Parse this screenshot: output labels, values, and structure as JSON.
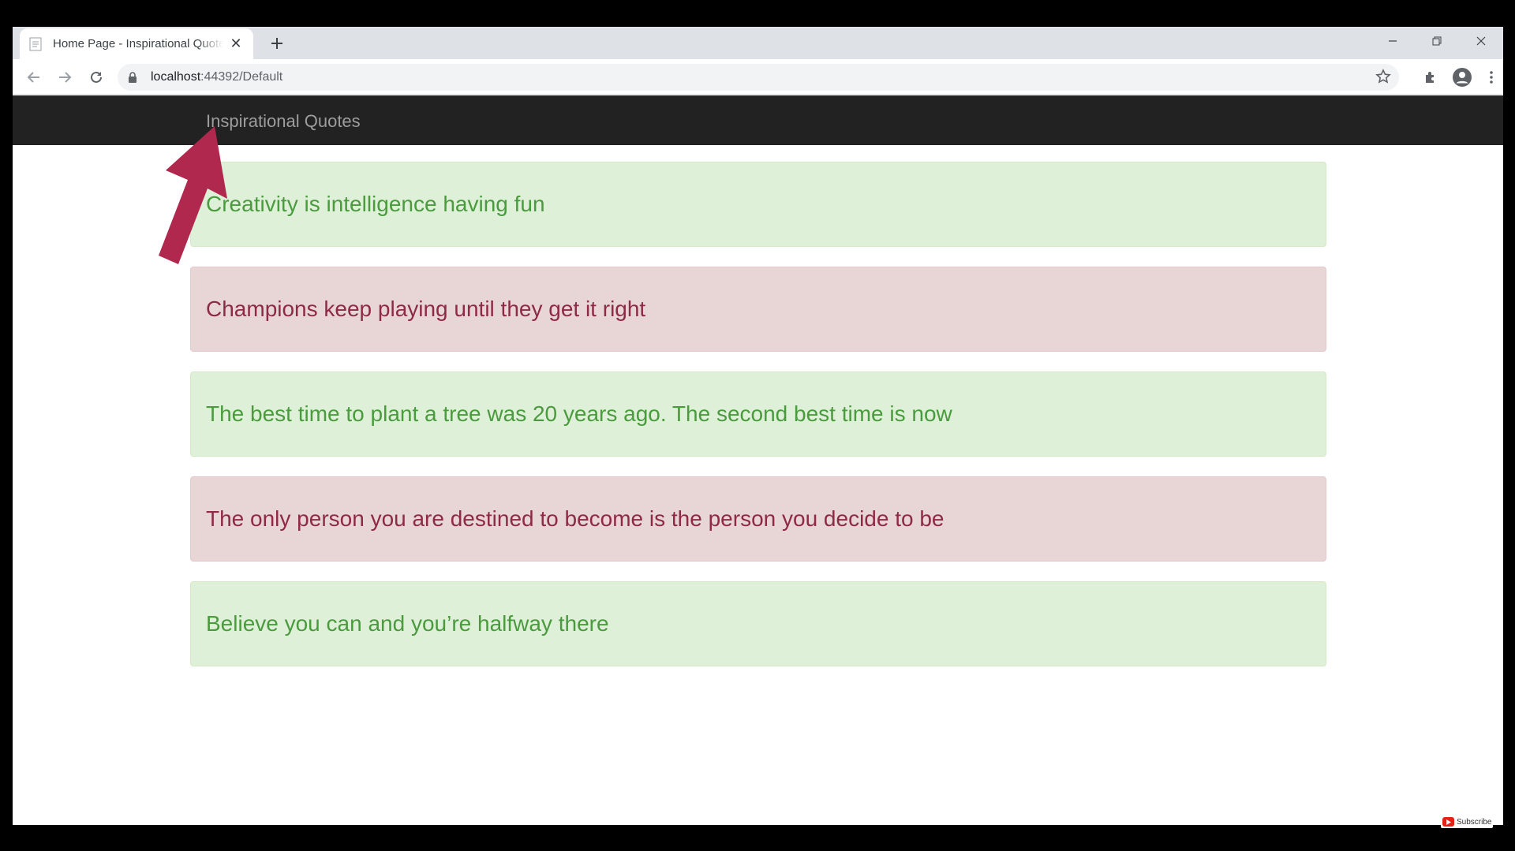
{
  "browser": {
    "tab": {
      "title": "Home Page - Inspirational Quotes"
    },
    "address": {
      "host": "localhost",
      "rest": ":44392/Default"
    }
  },
  "site": {
    "brand": "Inspirational Quotes"
  },
  "quotes": [
    {
      "text": "Creativity is intelligence having fun",
      "style": "success"
    },
    {
      "text": "Champions keep playing until they get it right",
      "style": "danger"
    },
    {
      "text": "The best time to plant a tree was 20 years ago. The second best time is now",
      "style": "success"
    },
    {
      "text": "The only person you are destined to become is the person you decide to be",
      "style": "danger"
    },
    {
      "text": "Believe you can and you’re halfway there",
      "style": "success"
    }
  ],
  "overlay": {
    "subscribe": "Subscribe"
  },
  "colors": {
    "navbar": "#222222",
    "success_bg": "#dff0d8",
    "danger_bg": "#e8d5d6",
    "arrow": "#b0284e"
  }
}
